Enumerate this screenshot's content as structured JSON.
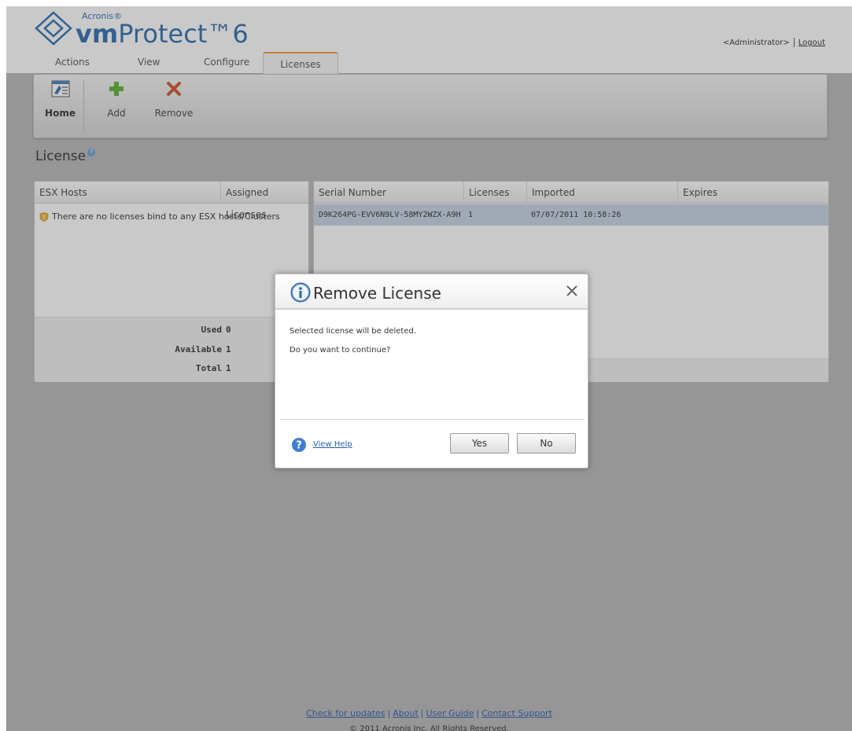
{
  "brand": {
    "small": "Acronis®",
    "main_bold": "vm",
    "main_rest": "Protect",
    "version": "6"
  },
  "user": {
    "name": "<Administrator>",
    "logout": "Logout"
  },
  "tabs": [
    {
      "label": "Actions"
    },
    {
      "label": "View"
    },
    {
      "label": "Configure"
    },
    {
      "label": "Licenses",
      "active": true
    }
  ],
  "ribbon": {
    "home": "Home",
    "add": "Add",
    "remove": "Remove"
  },
  "page": {
    "title": "License"
  },
  "hosts_table": {
    "columns": [
      "ESX Hosts",
      "Assigned Licenses"
    ],
    "empty_message": "There are no licenses bind to any ESX hosts/Clusters",
    "summary": [
      {
        "label": "Used",
        "value": "0"
      },
      {
        "label": "Available",
        "value": "1"
      },
      {
        "label": "Total",
        "value": "1"
      }
    ]
  },
  "licenses_table": {
    "columns": [
      "Serial Number",
      "Licenses",
      "Imported",
      "Expires"
    ],
    "rows": [
      {
        "serial": "D9K264PG-EVV6N9LV-58MY2WZX-A9H",
        "licenses": "1",
        "imported": "07/07/2011 10:58:26",
        "expires": ""
      }
    ]
  },
  "dialog": {
    "title": "Remove License",
    "line1": "Selected license will be deleted.",
    "line2": "Do you want to continue?",
    "help": "View Help",
    "yes": "Yes",
    "no": "No"
  },
  "footer": {
    "links": [
      "Check for updates",
      "About",
      "User Guide",
      "Contact Support"
    ],
    "copyright": "© 2011 Acronis Inc. All Rights Reserved."
  },
  "colors": {
    "brand_blue": "#2f6fb1",
    "active_tab": "#f0a030",
    "selected_row": "#c6d3e3",
    "add_green": "#5fb335",
    "remove_red": "#d0542b"
  }
}
